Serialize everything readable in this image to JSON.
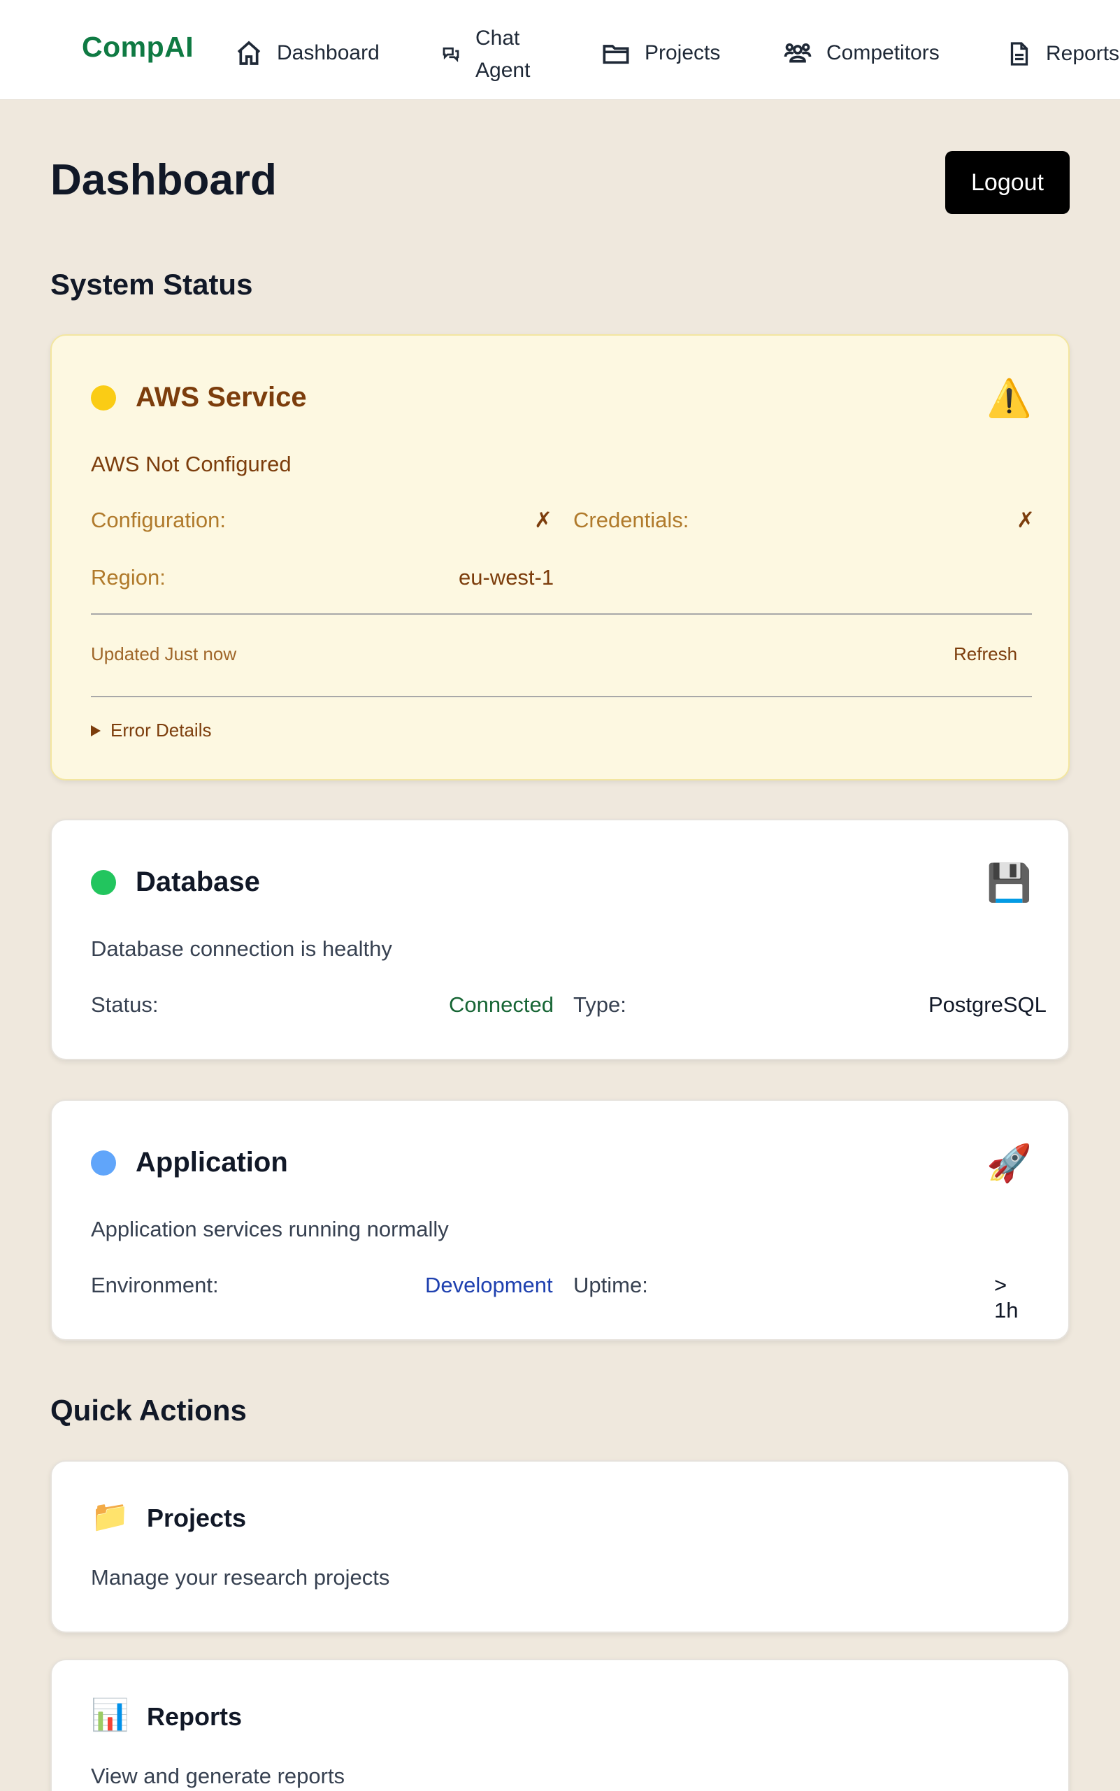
{
  "nav": {
    "brand": "CompAI",
    "items": [
      {
        "label": "Dashboard",
        "icon": "home-icon"
      },
      {
        "label_line1": "Chat",
        "label_line2": "Agent",
        "icon": "chat-icon"
      },
      {
        "label": "Projects",
        "icon": "folder-icon"
      },
      {
        "label": "Competitors",
        "icon": "users-icon"
      },
      {
        "label": "Reports",
        "icon": "document-icon"
      }
    ]
  },
  "header": {
    "title": "Dashboard",
    "logout_label": "Logout"
  },
  "system_status": {
    "title": "System Status",
    "aws": {
      "title": "AWS Service",
      "status_color": "#facc15",
      "icon": "warning-icon",
      "emoji": "⚠️",
      "message": "AWS Not Configured",
      "configuration_label": "Configuration:",
      "configuration_value": "✗",
      "credentials_label": "Credentials:",
      "credentials_value": "✗",
      "region_label": "Region:",
      "region_value": "eu-west-1",
      "updated": "Updated Just now",
      "refresh_label": "Refresh",
      "error_details_label": "Error Details"
    },
    "database": {
      "title": "Database",
      "status_color": "#22c55e",
      "icon": "floppy-disk-icon",
      "emoji": "💾",
      "message": "Database connection is healthy",
      "status_label": "Status:",
      "status_value": "Connected",
      "status_value_color": "#166534",
      "type_label": "Type:",
      "type_value": "PostgreSQL"
    },
    "application": {
      "title": "Application",
      "status_color": "#60a5fa",
      "icon": "rocket-icon",
      "emoji": "🚀",
      "message": "Application services running normally",
      "environment_label": "Environment:",
      "environment_value": "Development",
      "environment_value_color": "#1e40af",
      "uptime_label": "Uptime:",
      "uptime_value": "> 1h"
    }
  },
  "quick_actions": {
    "title": "Quick Actions",
    "items": [
      {
        "title": "Projects",
        "description": "Manage your research projects",
        "icon": "folder-icon",
        "emoji": "📁"
      },
      {
        "title": "Reports",
        "description": "View and generate reports",
        "icon": "bar-chart-icon",
        "emoji": "📊"
      }
    ]
  }
}
